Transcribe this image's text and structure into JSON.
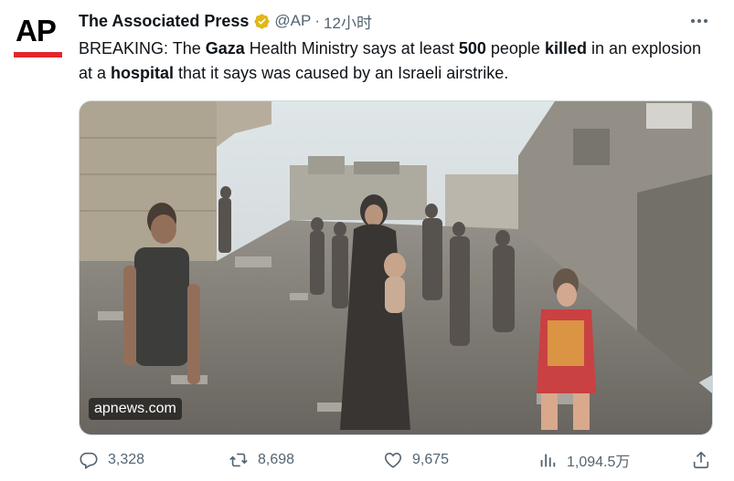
{
  "author": {
    "name": "The Associated Press",
    "handle": "@AP",
    "separator": "·",
    "time": "12小时",
    "avatar_text": "AP",
    "verified": true
  },
  "tweet": {
    "parts": [
      {
        "text": "BREAKING: The ",
        "bold": false
      },
      {
        "text": "Gaza",
        "bold": true
      },
      {
        "text": " Health Ministry says at least ",
        "bold": false
      },
      {
        "text": "500",
        "bold": true
      },
      {
        "text": " people ",
        "bold": false
      },
      {
        "text": "killed",
        "bold": true
      },
      {
        "text": " in an explosion at a ",
        "bold": false
      },
      {
        "text": "hospital",
        "bold": true
      },
      {
        "text": " that it says was caused by an Israeli airstrike.",
        "bold": false
      }
    ]
  },
  "media": {
    "watermark": "apnews.com"
  },
  "actions": {
    "replies": "3,328",
    "retweets": "8,698",
    "likes": "9,675",
    "views": "1,094.5万"
  },
  "icons": {
    "verified": "verified-badge-icon",
    "more": "more-options-icon",
    "reply": "reply-icon",
    "retweet": "retweet-icon",
    "like": "heart-icon",
    "views": "analytics-icon",
    "share": "share-icon"
  },
  "colors": {
    "verified_gold": "#e2b719",
    "brand_red": "#e3262a",
    "secondary_text": "#536471",
    "primary_text": "#0f1419"
  }
}
